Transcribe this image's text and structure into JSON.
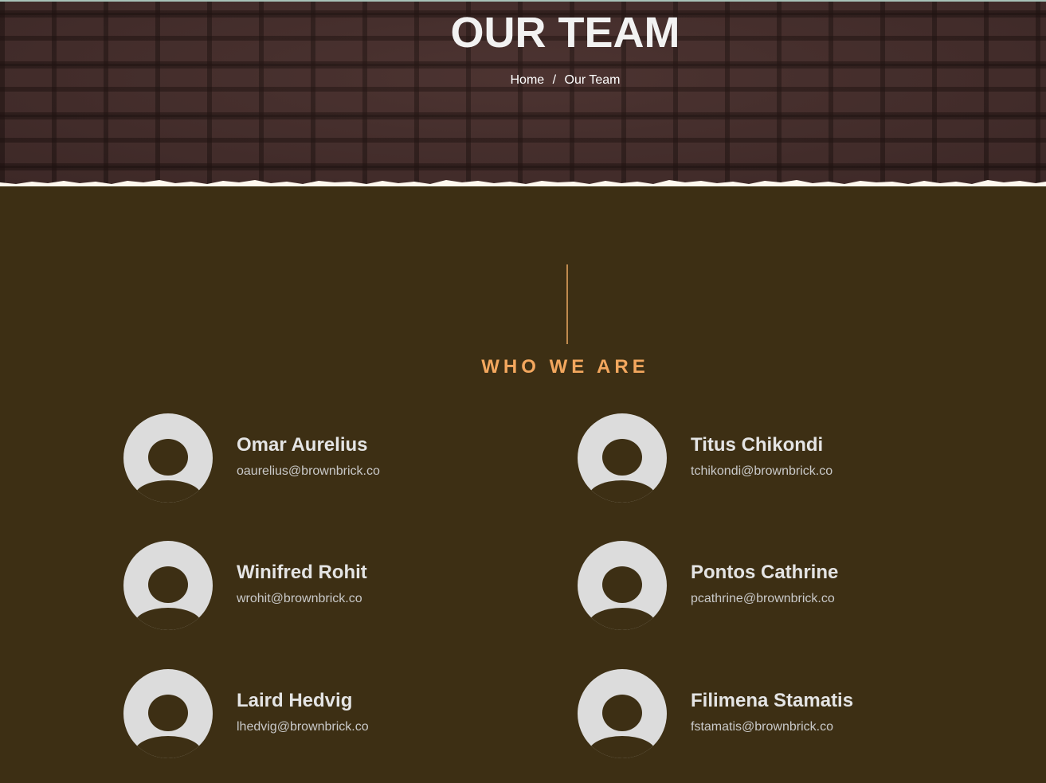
{
  "hero": {
    "title": "OUR TEAM",
    "breadcrumb": {
      "home": "Home",
      "separator": "/",
      "current": "Our Team"
    }
  },
  "section": {
    "title": "WHO WE ARE"
  },
  "team": [
    {
      "name": "Omar Aurelius",
      "email": "oaurelius@brownbrick.co"
    },
    {
      "name": "Titus Chikondi",
      "email": "tchikondi@brownbrick.co"
    },
    {
      "name": "Winifred Rohit",
      "email": "wrohit@brownbrick.co"
    },
    {
      "name": "Pontos Cathrine",
      "email": "pcathrine@brownbrick.co"
    },
    {
      "name": "Laird Hedvig",
      "email": "lhedvig@brownbrick.co"
    },
    {
      "name": "Filimena Stamatis",
      "email": "fstamatis@brownbrick.co"
    }
  ],
  "colors": {
    "background": "#3d2f14",
    "accent": "#f3a75e",
    "divider": "#c08a4e",
    "avatar": "#dcdcdc",
    "hero_brick": "#4a3230"
  },
  "icons": {
    "avatar": "user-placeholder-icon"
  }
}
